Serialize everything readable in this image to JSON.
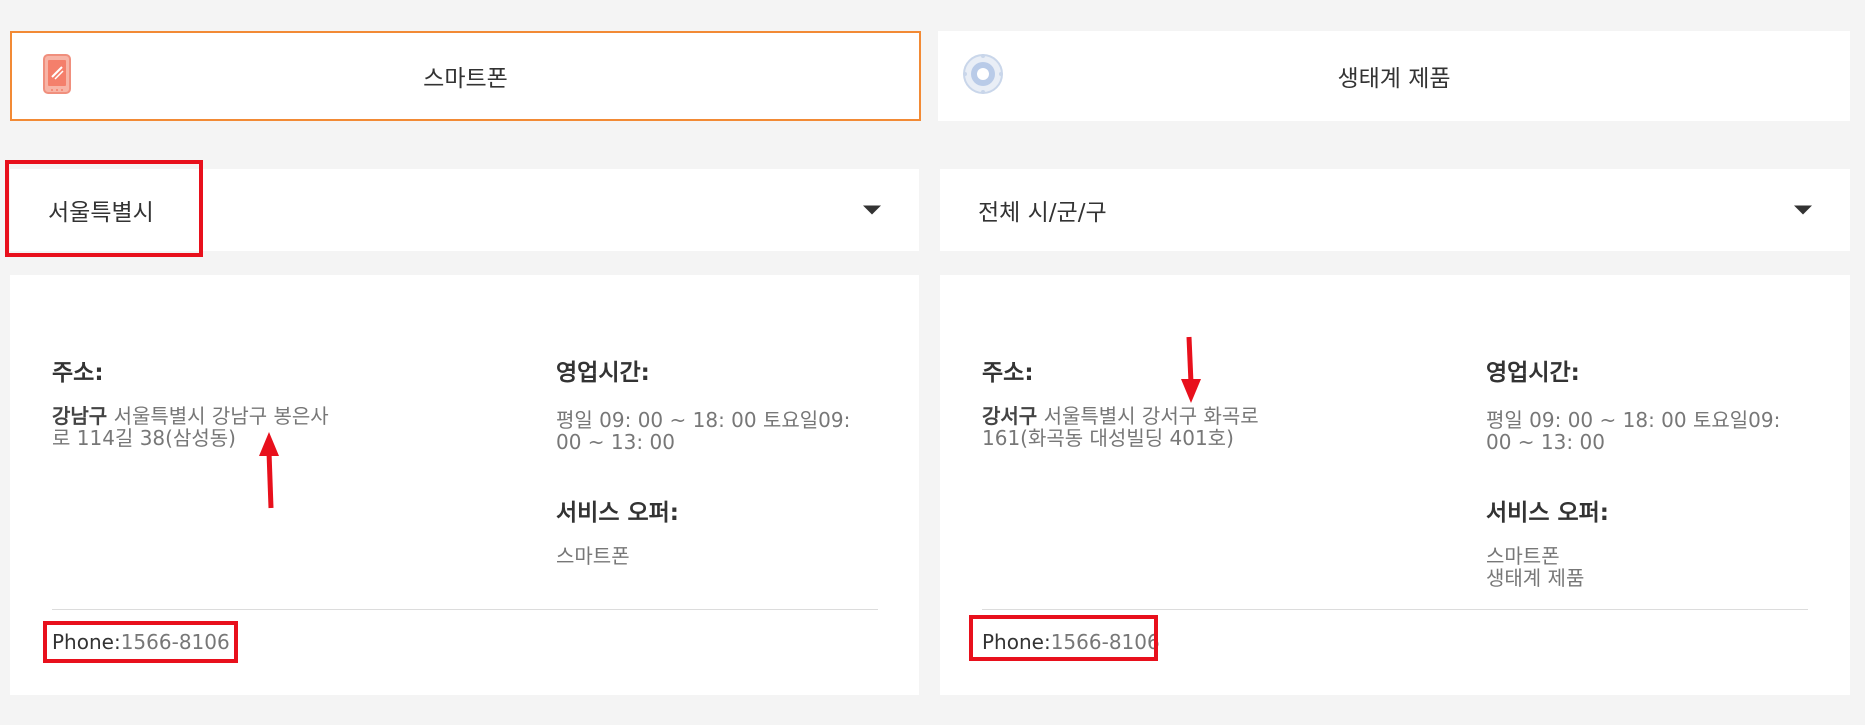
{
  "tabs": [
    {
      "label": "스마트폰",
      "icon": "smartphone-icon",
      "active": true
    },
    {
      "label": "생태계 제품",
      "icon": "ecosystem-icon",
      "active": false
    }
  ],
  "dropdowns": {
    "city": {
      "value": "서울특별시"
    },
    "district": {
      "value": "전체 시/군/구"
    }
  },
  "stores": [
    {
      "address_label": "주소:",
      "address_district": "강남구",
      "address_line1": "서울특별시 강남구 봉은사",
      "address_line2": "로 114길 38(삼성동)",
      "hours_label": "영업시간:",
      "hours_line1": "평일 09: 00 ~ 18: 00 토요일09:",
      "hours_line2": "00 ~ 13: 00",
      "services_label": "서비스 오퍼:",
      "services": [
        "스마트폰"
      ],
      "phone_label": "Phone:",
      "phone": "1566-8106"
    },
    {
      "address_label": "주소:",
      "address_district": "강서구",
      "address_line1": "서울특별시 강서구 화곡로",
      "address_line2": "161(화곡동 대성빌딩 401호)",
      "hours_label": "영업시간:",
      "hours_line1": "평일 09: 00 ~ 18: 00 토요일09:",
      "hours_line2": "00 ~ 13: 00",
      "services_label": "서비스 오퍼:",
      "services": [
        "스마트폰",
        "생태계 제품"
      ],
      "phone_label": "Phone:",
      "phone": "1566-8106"
    }
  ],
  "colors": {
    "accent": "#f28a35",
    "annotation": "#e8101c",
    "background": "#f4f4f4"
  }
}
